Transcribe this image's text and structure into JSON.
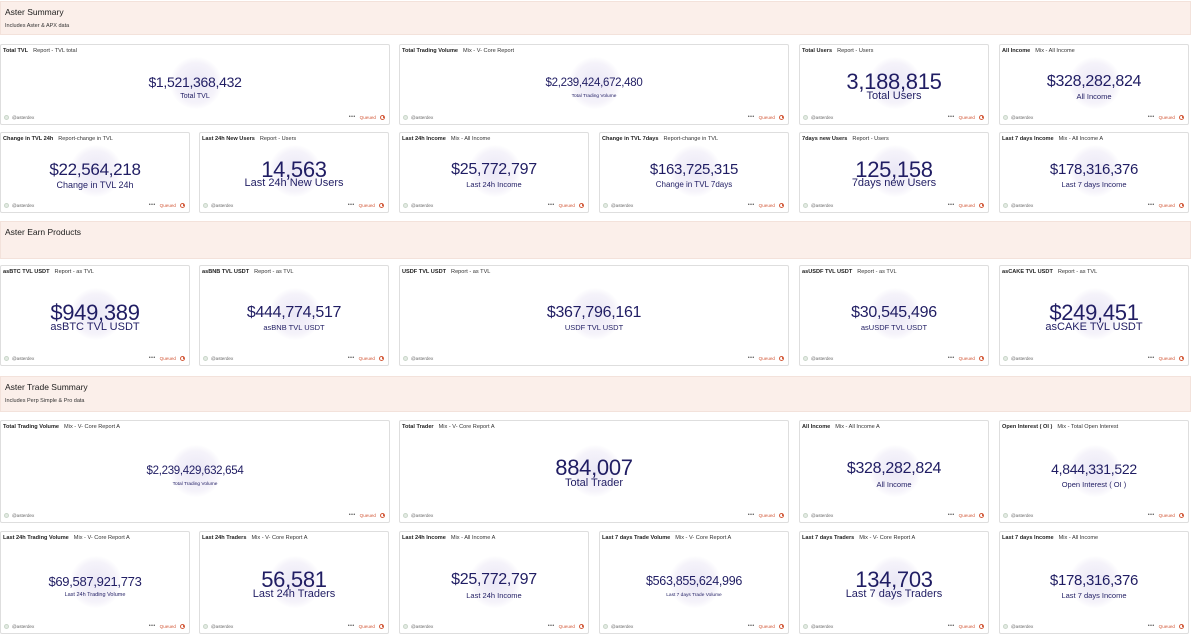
{
  "sections": [
    {
      "title": "Aster Summary",
      "subtitle": "Includes Aster & APX data"
    },
    {
      "title": "Aster Earn Products",
      "subtitle": ""
    },
    {
      "title": "Aster Trade Summary",
      "subtitle": "Includes Perp Simple & Pro data"
    }
  ],
  "footer": {
    "source": "@asterdex",
    "menu": "•••",
    "status": "Queued"
  },
  "cards": [
    {
      "title": "Total TVL",
      "subtitle": "Report - TVL total",
      "value": "$1,521,368,432",
      "label": "Total TVL"
    },
    {
      "title": "Total Trading Volume",
      "subtitle": "Mix - V- Core Report",
      "value": "$2,239,424,672,480",
      "label": "Total Trading Volume"
    },
    {
      "title": "Total Users",
      "subtitle": "Report - Users",
      "value": "3,188,815",
      "label": "Total Users"
    },
    {
      "title": "All Income",
      "subtitle": "Mix - All Income",
      "value": "$328,282,824",
      "label": "All Income"
    },
    {
      "title": "Change in TVL 24h",
      "subtitle": "Report-change in TVL",
      "value": "$22,564,218",
      "label": "Change in TVL 24h"
    },
    {
      "title": "Last 24h New Users",
      "subtitle": "Report - Users",
      "value": "14,563",
      "label": "Last 24h New Users"
    },
    {
      "title": "Last 24h Income",
      "subtitle": "Mix - All Income",
      "value": "$25,772,797",
      "label": "Last 24h Income"
    },
    {
      "title": "Change in TVL 7days",
      "subtitle": "Report-change in TVL",
      "value": "$163,725,315",
      "label": "Change in TVL 7days"
    },
    {
      "title": "7days new Users",
      "subtitle": "Report - Users",
      "value": "125,158",
      "label": "7days new Users"
    },
    {
      "title": "Last 7 days Income",
      "subtitle": "Mix - All Income A",
      "value": "$178,316,376",
      "label": "Last 7 days Income"
    },
    {
      "title": "asBTC TVL USDT",
      "subtitle": "Report - as TVL",
      "value": "$949,389",
      "label": "asBTC TVL USDT"
    },
    {
      "title": "asBNB TVL USDT",
      "subtitle": "Report - as TVL",
      "value": "$444,774,517",
      "label": "asBNB TVL USDT"
    },
    {
      "title": "USDF TVL USDT",
      "subtitle": "Report - as TVL",
      "value": "$367,796,161",
      "label": "USDF TVL USDT"
    },
    {
      "title": "asUSDF TVL USDT",
      "subtitle": "Report - as TVL",
      "value": "$30,545,496",
      "label": "asUSDF TVL USDT"
    },
    {
      "title": "asCAKE TVL USDT",
      "subtitle": "Report - as TVL",
      "value": "$249,451",
      "label": "asCAKE TVL USDT"
    },
    {
      "title": "Total Trading Volume",
      "subtitle": "Mix - V- Core Report A",
      "value": "$2,239,429,632,654",
      "label": "Total Trading Volume"
    },
    {
      "title": "Total Trader",
      "subtitle": "Mix - V- Core Report A",
      "value": "884,007",
      "label": "Total Trader"
    },
    {
      "title": "All Income",
      "subtitle": "Mix - All Income A",
      "value": "$328,282,824",
      "label": "All Income"
    },
    {
      "title": "Open Interest ( OI )",
      "subtitle": "Mix - Total Open Interest",
      "value": "4,844,331,522",
      "label": "Open Interest ( OI )"
    },
    {
      "title": "Last 24h Trading Volume",
      "subtitle": "Mix - V- Core Report A",
      "value": "$69,587,921,773",
      "label": "Last 24h Trading Volume"
    },
    {
      "title": "Last 24h Traders",
      "subtitle": "Mix - V- Core Report A",
      "value": "56,581",
      "label": "Last 24h Traders"
    },
    {
      "title": "Last 24h Income",
      "subtitle": "Mix - All Income A",
      "value": "$25,772,797",
      "label": "Last 24h Income"
    },
    {
      "title": "Last 7 days Trade Volume",
      "subtitle": "Mix - V- Core Report A",
      "value": "$563,855,624,996",
      "label": "Last 7 days Trade Volume"
    },
    {
      "title": "Last 7 days Traders",
      "subtitle": "Mix - V- Core Report A",
      "value": "134,703",
      "label": "Last 7 days Traders"
    },
    {
      "title": "Last 7 days Income",
      "subtitle": "Mix - All Income",
      "value": "$178,316,376",
      "label": "Last 7 days Income"
    }
  ]
}
